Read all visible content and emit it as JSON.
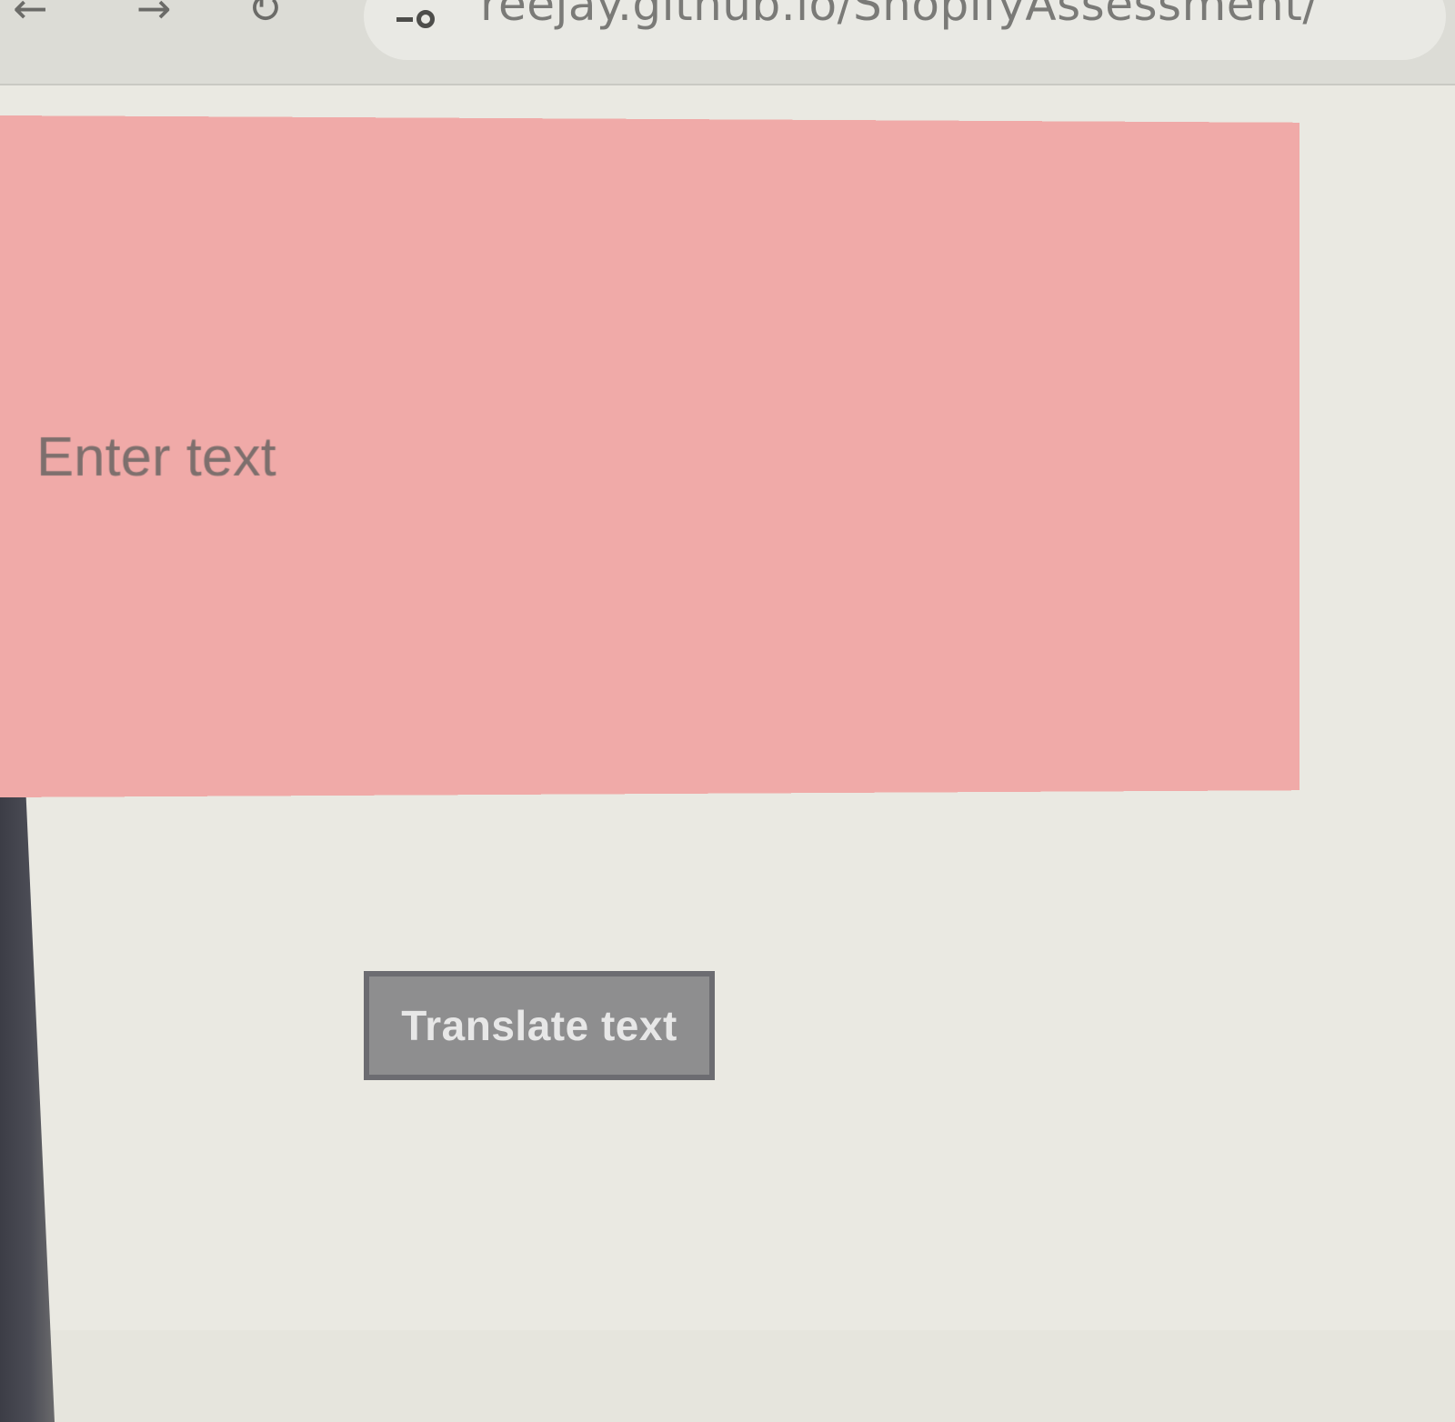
{
  "browser": {
    "url": "reejay.github.io/ShopifyAssessment/",
    "back_icon": "arrow-left-icon",
    "forward_icon": "arrow-right-icon",
    "reload_icon": "reload-icon",
    "site_info_icon": "tune-icon"
  },
  "page": {
    "input_placeholder": "Enter text",
    "input_value": "",
    "translate_button_label": "Translate text"
  },
  "colors": {
    "input_background": "#f0aaa8",
    "button_background": "#8e8e8f",
    "button_border": "#6c6c71",
    "page_background": "#eae9e2"
  }
}
